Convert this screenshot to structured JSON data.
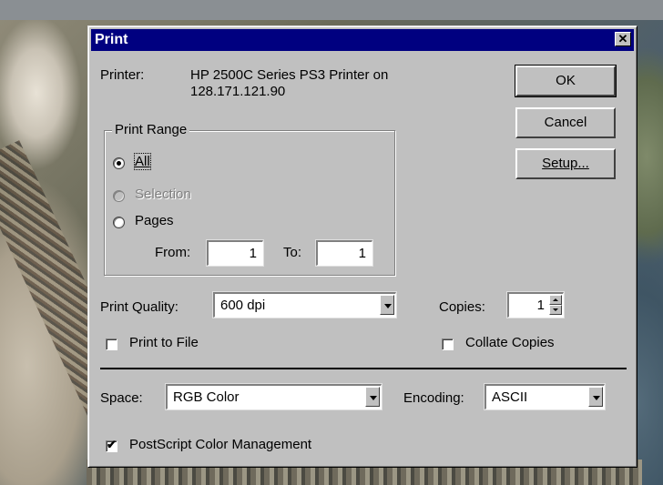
{
  "dialog": {
    "title": "Print",
    "close_glyph": "✕",
    "printer_label": "Printer:",
    "printer_name_line1": "HP 2500C Series PS3 Printer on",
    "printer_name_line2": "128.171.121.90"
  },
  "buttons": {
    "ok": "OK",
    "cancel": "Cancel",
    "setup": "Setup..."
  },
  "print_range": {
    "legend": "Print Range",
    "all": "All",
    "selection": "Selection",
    "pages": "Pages",
    "from_label": "From:",
    "from_value": "1",
    "to_label": "To:",
    "to_value": "1",
    "selected": "all"
  },
  "print_quality": {
    "label": "Print Quality:",
    "value": "600 dpi"
  },
  "copies": {
    "label": "Copies:",
    "value": "1"
  },
  "print_to_file": {
    "label": "Print to File",
    "checked": false
  },
  "collate": {
    "label": "Collate Copies",
    "checked": false
  },
  "space": {
    "label": "Space:",
    "value": "RGB Color"
  },
  "encoding": {
    "label": "Encoding:",
    "value": "ASCII"
  },
  "postscript_cm": {
    "label": "PostScript Color Management",
    "checked": true,
    "mark": "✔"
  },
  "colors": {
    "titlebar": "#000080",
    "dialog_face": "#c0c0c0"
  },
  "icons": [
    "close-icon",
    "dropdown-arrow-icon",
    "spin-up-icon",
    "spin-down-icon",
    "checkmark-icon"
  ]
}
